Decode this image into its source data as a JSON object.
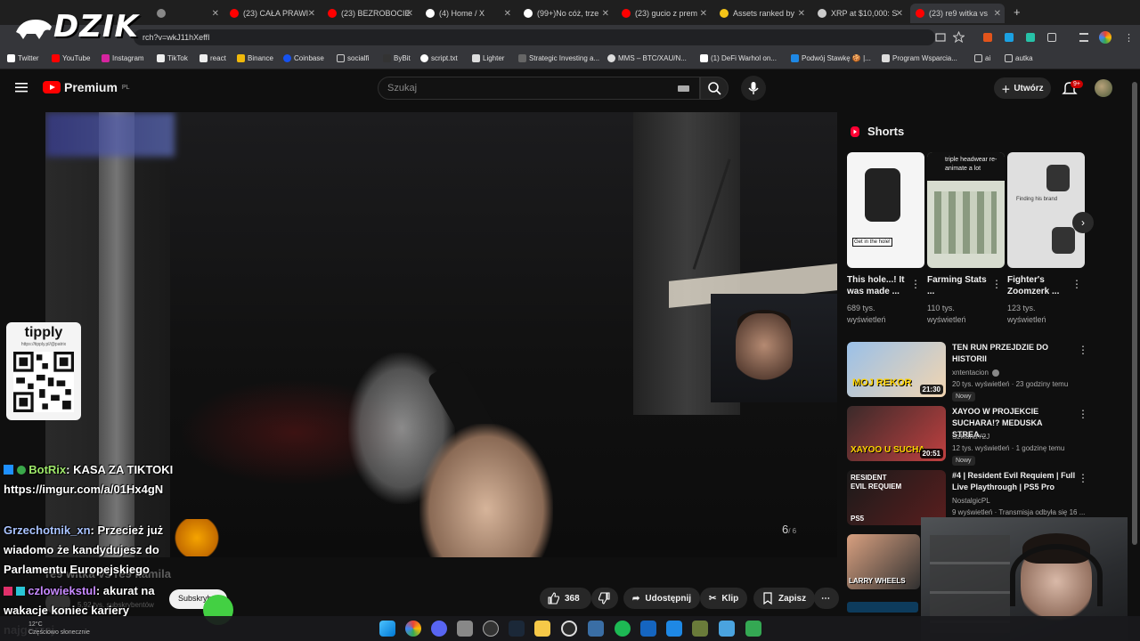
{
  "browser": {
    "tabs": [
      {
        "label": "",
        "color": "#888888"
      },
      {
        "label": "",
        "color": "#888888"
      },
      {
        "label": "(23) CAŁA PRAWI",
        "color": "#ff0000"
      },
      {
        "label": "(23) BEZROBOCIE",
        "color": "#ff0000"
      },
      {
        "label": "(4) Home / X",
        "color": "#ffffff"
      },
      {
        "label": "(99+)No cóż, trze",
        "color": "#ffffff"
      },
      {
        "label": "(23) gucio z prem",
        "color": "#ff0000"
      },
      {
        "label": "Assets ranked by",
        "color": "#f5c518"
      },
      {
        "label": "XRP at $10,000: S",
        "color": "#cccccc"
      },
      {
        "label": "(23) re9 witka vs",
        "color": "#ff0000"
      }
    ],
    "new_tab": "+",
    "url": "rch?v=wkJ11hXeffI",
    "bookmarks": [
      "Twitter",
      "YouTube",
      "Instagram",
      "TikTok",
      "react",
      "Binance",
      "Coinbase",
      "socialfi",
      "ByBit",
      "script.txt",
      "Lighter",
      "Strategic Investing a...",
      "MMS – BTC/XAU/N...",
      "(1) DeFi Warhol on...",
      "Podwój Stawkę 🍪 |...",
      "Program Wsparcia...",
      "ai",
      "autka"
    ]
  },
  "overlay": {
    "logo": "DZIK",
    "tipply_name": "tipply",
    "tipply_url": "https://tipply.pl/@patrix"
  },
  "youtube": {
    "logo_text": "Premium",
    "logo_region": "PL",
    "search_placeholder": "Szukaj",
    "create_label": "Utwórz",
    "notifications_badge": "9+",
    "video": {
      "title": "re9 witka vs re9 kamila",
      "subscribers": "5,92 tys. subskrybentów",
      "subscribe_label": "Subskrybuj",
      "likes": "368",
      "share_label": "Udostępnij",
      "clip_label": "Klip",
      "save_label": "Zapisz",
      "ammo_current": "6",
      "ammo_total": "/ 6"
    },
    "shorts_heading": "Shorts",
    "shorts": [
      {
        "title": "This hole...! It was made ...",
        "views": "689 tys. wyświetleń"
      },
      {
        "title": "Farming Stats ...",
        "views": "110 tys. wyświetleń"
      },
      {
        "title": "Fighter's Zoomzerk ...",
        "views": "123 tys. wyświetleń"
      }
    ],
    "shorts_thumb_texts": [
      "Get in the hole!",
      "triple headwear re-animate a lot",
      "Finding his brand"
    ],
    "recommendations": [
      {
        "title": "TEN RUN PRZEJDZIE DO HISTORII",
        "channel": "xntentacion",
        "meta": "20 tys. wyświetleń · 23 godziny temu",
        "badge": "Nowy",
        "duration": "21:30",
        "thumb_text": "MOJ REKOR"
      },
      {
        "title": "XAYOO W PROJEKCIE SUCHARA!? MEDUSKA STREA...",
        "channel": "SzklanaY2J",
        "meta": "12 tys. wyświetleń · 1 godzinę temu",
        "badge": "Nowy",
        "duration": "20:51",
        "thumb_text": "XAYOO U SUCHA"
      },
      {
        "title": "#4 | Resident Evil Requiem | Full Live Playthrough | PS5 Pro",
        "channel": "NostalgicPL",
        "meta": "9 wyświetleń · Transmisja odbyła się 16 ...",
        "badge": "",
        "duration": "",
        "thumb_text": "RESIDENT EVIL REQUIEM"
      },
      {
        "title": "",
        "channel": "",
        "meta": "",
        "badge": "",
        "duration": "",
        "thumb_text": "LARRY WHEELS"
      }
    ]
  },
  "chat": [
    {
      "name": "BotRix",
      "text": ": KASA ZA TIKTOKI https://imgur.com/a/01Hx4gN"
    },
    {
      "name": "Grzechotnik_xn",
      "text": ": Przecież już wiadomo że kandydujesz do Parlamentu Europejskiego"
    },
    {
      "name": "czlowiekstul",
      "text": ": akurat na wakacje koniec kariery najgorzej"
    }
  ],
  "taskbar": {
    "weather_temp": "12°C",
    "weather_desc": "Częściowo słonecznie"
  }
}
